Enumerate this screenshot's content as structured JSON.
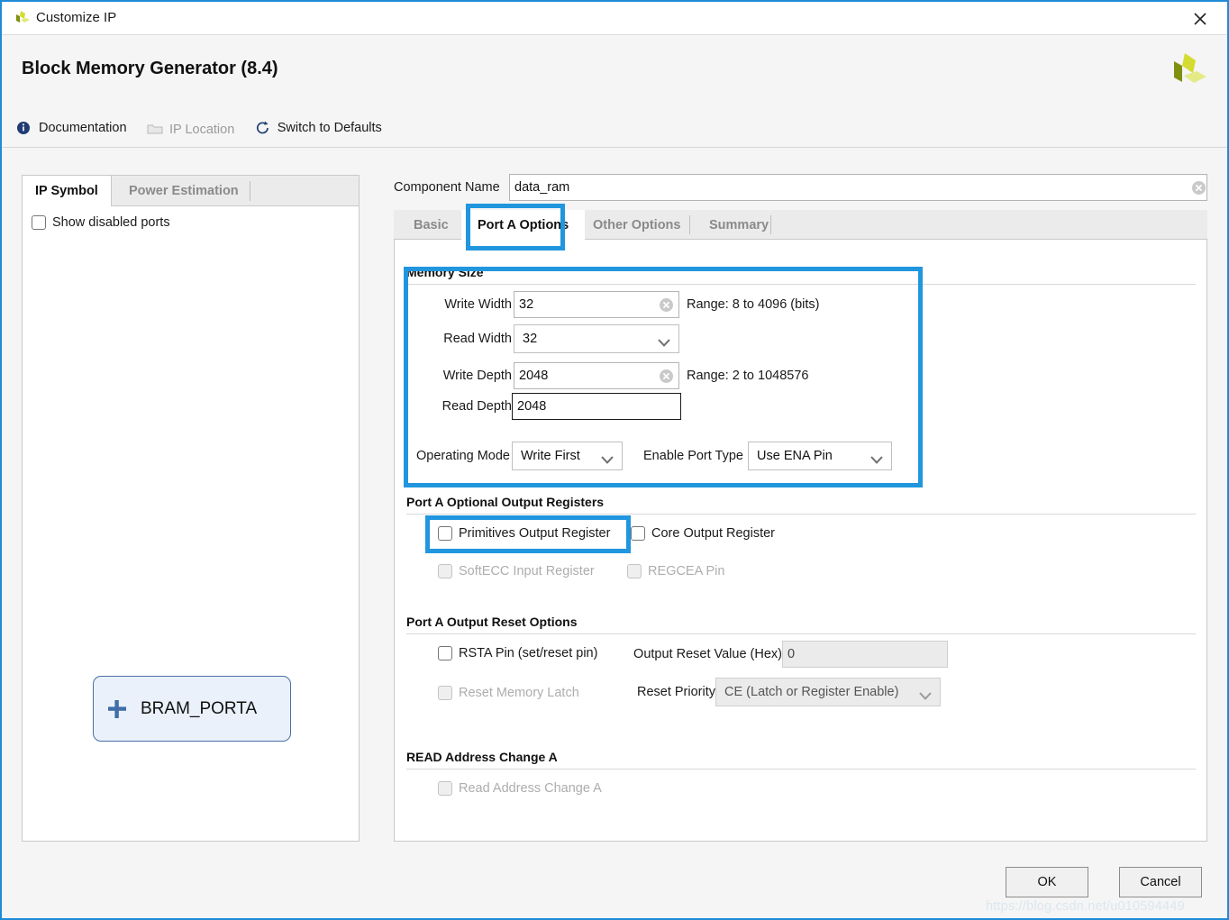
{
  "window": {
    "title": "Customize IP",
    "close_icon": "close-icon",
    "logo_icon": "xilinx-logo-icon"
  },
  "header": {
    "ip_title": "Block Memory Generator (8.4)",
    "links": [
      {
        "label": "Documentation",
        "icon": "info-icon",
        "disabled": false
      },
      {
        "label": "IP Location",
        "icon": "folder-icon",
        "disabled": true
      },
      {
        "label": "Switch to Defaults",
        "icon": "refresh-icon",
        "disabled": false
      }
    ]
  },
  "left_panel": {
    "tabs": [
      {
        "label": "IP Symbol",
        "active": true
      },
      {
        "label": "Power Estimation",
        "active": false
      }
    ],
    "show_disabled_ports": {
      "label": "Show disabled ports",
      "checked": false
    },
    "symbol": {
      "label": "BRAM_PORTA",
      "expander": "plus-icon",
      "bus_icon": "bus-connector-icon"
    }
  },
  "component_name": {
    "label": "Component Name",
    "value": "data_ram",
    "placeholder": "",
    "clear_icon": "clear-field-icon"
  },
  "tabs": [
    {
      "label": "Basic",
      "active": false
    },
    {
      "label": "Port A Options",
      "active": true
    },
    {
      "label": "Other Options",
      "active": false
    },
    {
      "label": "Summary",
      "active": false
    }
  ],
  "memory_size": {
    "section_title": "Memory Size",
    "write_width": {
      "label": "Write Width",
      "value": "32",
      "range": "Range: 8 to 4096 (bits)"
    },
    "read_width": {
      "label": "Read Width",
      "value": "32"
    },
    "write_depth": {
      "label": "Write Depth",
      "value": "2048",
      "range": "Range: 2 to 1048576"
    },
    "read_depth": {
      "label": "Read Depth",
      "value": "2048"
    },
    "operating_mode": {
      "label": "Operating Mode",
      "value": "Write First"
    },
    "enable_port_type": {
      "label": "Enable Port Type",
      "value": "Use ENA Pin"
    }
  },
  "optional_output_registers": {
    "section_title": "Port A Optional Output Registers",
    "items": [
      {
        "label": "Primitives Output Register",
        "checked": false,
        "disabled": false
      },
      {
        "label": "Core Output Register",
        "checked": false,
        "disabled": false
      },
      {
        "label": "SoftECC Input Register",
        "checked": false,
        "disabled": true
      },
      {
        "label": "REGCEA Pin",
        "checked": false,
        "disabled": true
      }
    ]
  },
  "output_reset_options": {
    "section_title": "Port A Output Reset Options",
    "rsta_pin": {
      "label": "RSTA Pin (set/reset pin)",
      "checked": false,
      "disabled": false
    },
    "reset_memory_latch": {
      "label": "Reset Memory Latch",
      "checked": false,
      "disabled": true
    },
    "output_reset_value": {
      "label": "Output Reset Value (Hex)",
      "value": "0"
    },
    "reset_priority": {
      "label": "Reset Priority",
      "value": "CE (Latch or Register Enable)"
    }
  },
  "read_address_change": {
    "section_title": "READ Address Change A",
    "checkbox": {
      "label": "Read Address Change A",
      "checked": false,
      "disabled": true
    }
  },
  "footer": {
    "ok_label": "OK",
    "cancel_label": "Cancel"
  },
  "watermark": "https://blog.csdn.net/u010594449",
  "colors": {
    "annotation": "#2196de",
    "window_border": "#1f8ad6",
    "link": "#1a1a1a",
    "logo_green": "#c8d22d"
  }
}
